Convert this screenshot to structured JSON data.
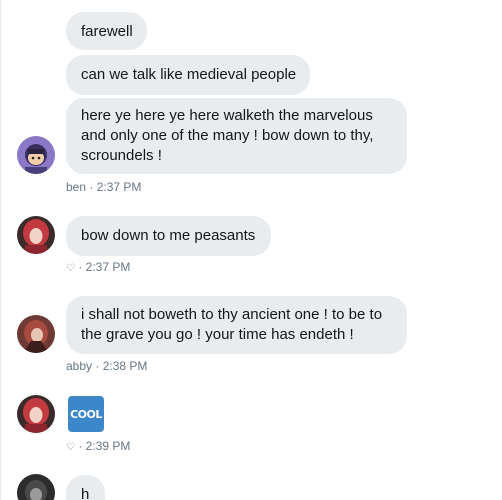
{
  "messages": [
    {
      "text": "farewell"
    },
    {
      "text": "can we talk like medieval people"
    },
    {
      "text": "here ye here ye here walketh the marvelous and only one of the many ! bow down to thy, scroundels !"
    },
    {
      "text": "bow down to me peasants"
    },
    {
      "text": "i shall not boweth to thy ancient one ! to be to the grave you go ! your time has endeth !"
    },
    {
      "sticker": "COOL"
    },
    {
      "text": "h"
    }
  ],
  "meta": [
    {
      "sender": "ben",
      "time": "2:37 PM"
    },
    {
      "icon": "heart-outline-icon",
      "time": "2:37 PM"
    },
    {
      "sender": "abby",
      "time": "2:38 PM"
    },
    {
      "icon": "heart-outline-icon",
      "time": "2:39 PM"
    }
  ],
  "separator": "·",
  "colors": {
    "bubble": "#e9ecef",
    "meta_text": "#657786",
    "sticker_bg": "#3b87c9"
  }
}
